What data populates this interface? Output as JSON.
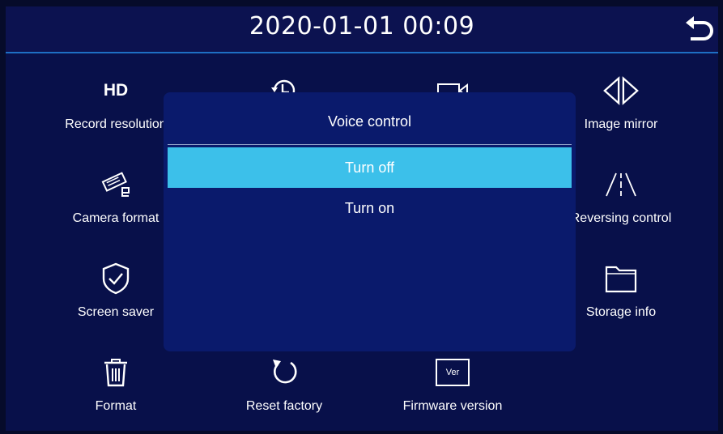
{
  "header": {
    "datetime": "2020-01-01  00:09",
    "back_icon": "back-arrow-icon"
  },
  "menu": {
    "record_resolution": {
      "label": "Record resolution",
      "icon_text": "HD"
    },
    "time": {
      "label": "",
      "icon": "clock-icon"
    },
    "video": {
      "label": "",
      "icon": "video-camera-icon"
    },
    "image_mirror": {
      "label": "Image mirror",
      "icon": "mirror-icon"
    },
    "camera_format": {
      "label": "Camera format",
      "icon": "cctv-camera-icon"
    },
    "reversing_control": {
      "label": "Reversing control",
      "icon": "road-icon"
    },
    "screen_saver": {
      "label": "Screen saver",
      "icon": "shield-check-icon"
    },
    "storage_info": {
      "label": "Storage info",
      "icon": "folder-icon"
    },
    "format": {
      "label": "Format",
      "icon": "trash-icon"
    },
    "reset_factory": {
      "label": "Reset factory",
      "icon": "reset-icon"
    },
    "firmware_version": {
      "label": "Firmware version",
      "icon_text": "Ver"
    }
  },
  "dialog": {
    "title": "Voice control",
    "options": [
      {
        "label": "Turn off",
        "selected": true
      },
      {
        "label": "Turn on",
        "selected": false
      }
    ]
  },
  "colors": {
    "background": "#08104a",
    "dialog": "#0a1a6c",
    "selected": "#3cc0ea",
    "accent_line": "#1e6fc4"
  }
}
